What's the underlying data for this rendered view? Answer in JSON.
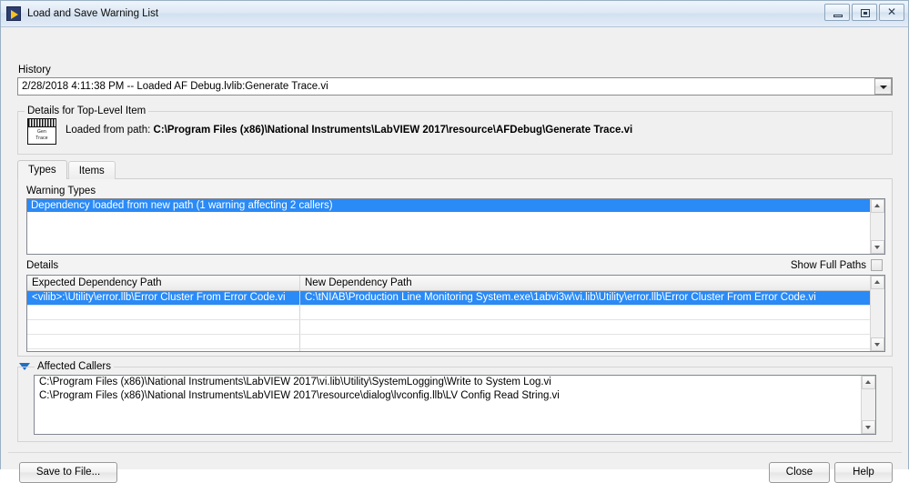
{
  "window": {
    "title": "Load and Save Warning List",
    "app_icon": "labview-run-arrow-icon",
    "minimize_label": "",
    "maximize_label": "",
    "close_label": "✕"
  },
  "history": {
    "label": "History",
    "selected_value": "2/28/2018 4:11:38 PM -- Loaded AF Debug.lvlib:Generate Trace.vi",
    "options": [
      "2/28/2018 4:11:38 PM -- Loaded AF Debug.lvlib:Generate Trace.vi"
    ]
  },
  "top_level_details": {
    "group_title": "Details for Top-Level Item",
    "icon_line1": "Gen",
    "icon_line2": "Trace",
    "prefix": "Loaded from path: ",
    "path": "C:\\Program Files (x86)\\National Instruments\\LabVIEW 2017\\resource\\AFDebug\\Generate Trace.vi"
  },
  "tabs": [
    {
      "label": "Types",
      "active": true
    },
    {
      "label": "Items",
      "active": false
    }
  ],
  "warning_types": {
    "label": "Warning Types",
    "rows": [
      {
        "text": "Dependency loaded from new path (1 warning affecting 2 callers)",
        "selected": true
      }
    ]
  },
  "details": {
    "label": "Details",
    "show_full_paths_label": "Show Full Paths",
    "show_full_paths_checked": false,
    "columns": [
      "Expected Dependency Path",
      "New Dependency Path"
    ],
    "rows": [
      {
        "selected": true,
        "expected": "<vilib>:\\Utility\\error.llb\\Error Cluster From Error Code.vi",
        "new": "C:\\tNIAB\\Production Line Monitoring System.exe\\1abvi3w\\vi.lib\\Utility\\error.llb\\Error Cluster From Error Code.vi"
      }
    ]
  },
  "affected_callers": {
    "label": "Affected Callers",
    "expanded": true,
    "rows": [
      "C:\\Program Files (x86)\\National Instruments\\LabVIEW 2017\\vi.lib\\Utility\\SystemLogging\\Write to System Log.vi",
      "C:\\Program Files (x86)\\National Instruments\\LabVIEW 2017\\resource\\dialog\\lvconfig.llb\\LV Config Read String.vi"
    ]
  },
  "footer": {
    "save_label": "Save to File...",
    "close_label": "Close",
    "help_label": "Help"
  },
  "colors": {
    "selection_blue": "#2a8af6",
    "disclosure_blue": "#1f6fc4",
    "icon_yellow": "#f7c223",
    "window_bg": "#f0f0f0"
  }
}
